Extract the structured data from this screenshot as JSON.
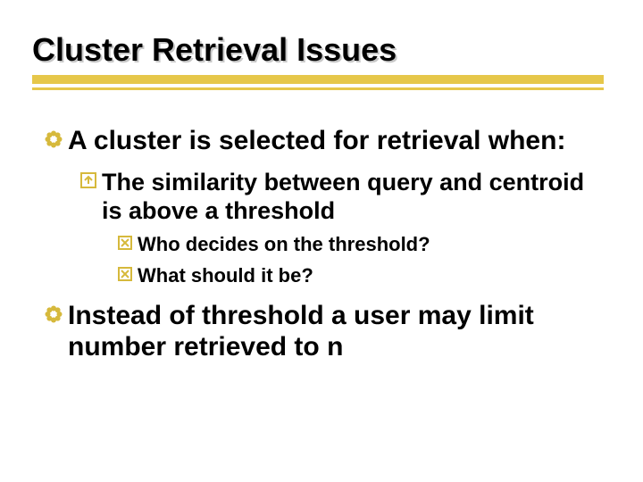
{
  "slide": {
    "title": "Cluster Retrieval Issues",
    "bullets": {
      "b1": "A cluster is selected for retrieval when:",
      "b1_1": "The similarity between query and centroid is above a threshold",
      "b1_1_1": "Who decides on the threshold?",
      "b1_1_2": "What should it be?",
      "b2": "Instead of threshold a user may limit number retrieved to n"
    }
  },
  "colors": {
    "accent": "#e6c74a",
    "bullet1": "#d6b93c",
    "bullet2": "#d6b93c",
    "bullet3": "#d6b93c"
  }
}
